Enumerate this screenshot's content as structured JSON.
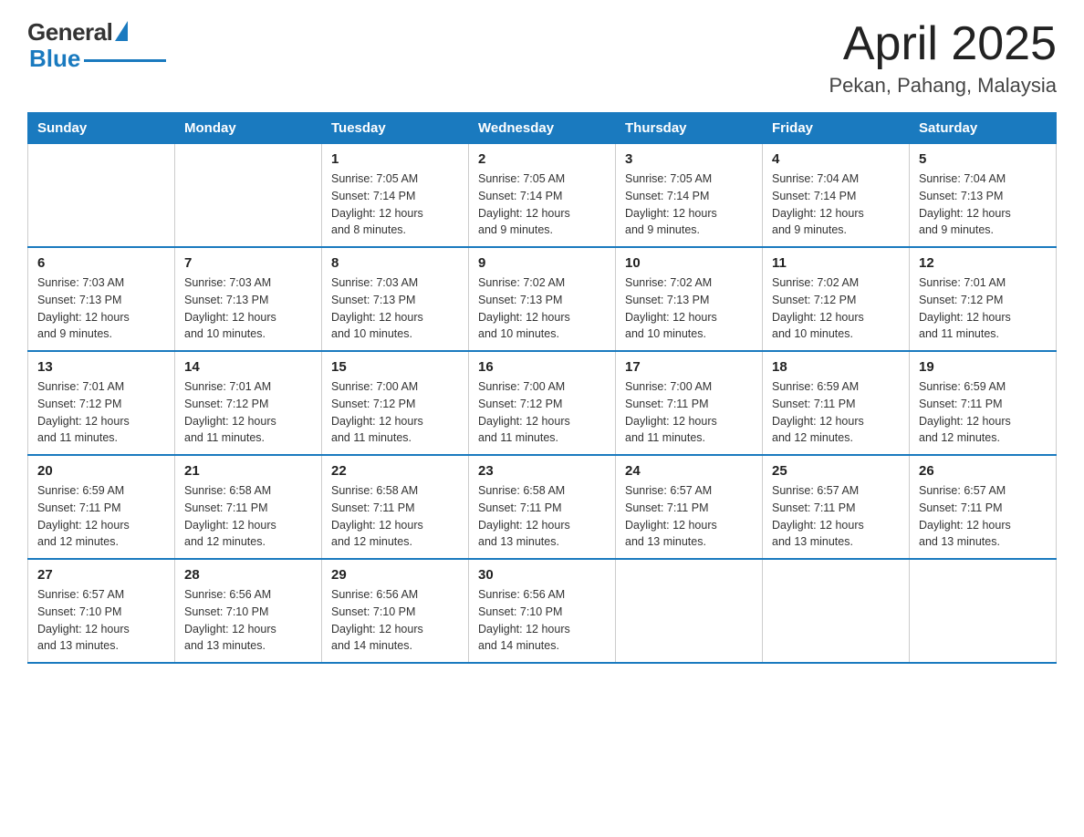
{
  "header": {
    "logo": {
      "general": "General",
      "blue": "Blue"
    },
    "title": "April 2025",
    "location": "Pekan, Pahang, Malaysia"
  },
  "days_of_week": [
    "Sunday",
    "Monday",
    "Tuesday",
    "Wednesday",
    "Thursday",
    "Friday",
    "Saturday"
  ],
  "weeks": [
    [
      {
        "day": "",
        "info": ""
      },
      {
        "day": "",
        "info": ""
      },
      {
        "day": "1",
        "info": "Sunrise: 7:05 AM\nSunset: 7:14 PM\nDaylight: 12 hours\nand 8 minutes."
      },
      {
        "day": "2",
        "info": "Sunrise: 7:05 AM\nSunset: 7:14 PM\nDaylight: 12 hours\nand 9 minutes."
      },
      {
        "day": "3",
        "info": "Sunrise: 7:05 AM\nSunset: 7:14 PM\nDaylight: 12 hours\nand 9 minutes."
      },
      {
        "day": "4",
        "info": "Sunrise: 7:04 AM\nSunset: 7:14 PM\nDaylight: 12 hours\nand 9 minutes."
      },
      {
        "day": "5",
        "info": "Sunrise: 7:04 AM\nSunset: 7:13 PM\nDaylight: 12 hours\nand 9 minutes."
      }
    ],
    [
      {
        "day": "6",
        "info": "Sunrise: 7:03 AM\nSunset: 7:13 PM\nDaylight: 12 hours\nand 9 minutes."
      },
      {
        "day": "7",
        "info": "Sunrise: 7:03 AM\nSunset: 7:13 PM\nDaylight: 12 hours\nand 10 minutes."
      },
      {
        "day": "8",
        "info": "Sunrise: 7:03 AM\nSunset: 7:13 PM\nDaylight: 12 hours\nand 10 minutes."
      },
      {
        "day": "9",
        "info": "Sunrise: 7:02 AM\nSunset: 7:13 PM\nDaylight: 12 hours\nand 10 minutes."
      },
      {
        "day": "10",
        "info": "Sunrise: 7:02 AM\nSunset: 7:13 PM\nDaylight: 12 hours\nand 10 minutes."
      },
      {
        "day": "11",
        "info": "Sunrise: 7:02 AM\nSunset: 7:12 PM\nDaylight: 12 hours\nand 10 minutes."
      },
      {
        "day": "12",
        "info": "Sunrise: 7:01 AM\nSunset: 7:12 PM\nDaylight: 12 hours\nand 11 minutes."
      }
    ],
    [
      {
        "day": "13",
        "info": "Sunrise: 7:01 AM\nSunset: 7:12 PM\nDaylight: 12 hours\nand 11 minutes."
      },
      {
        "day": "14",
        "info": "Sunrise: 7:01 AM\nSunset: 7:12 PM\nDaylight: 12 hours\nand 11 minutes."
      },
      {
        "day": "15",
        "info": "Sunrise: 7:00 AM\nSunset: 7:12 PM\nDaylight: 12 hours\nand 11 minutes."
      },
      {
        "day": "16",
        "info": "Sunrise: 7:00 AM\nSunset: 7:12 PM\nDaylight: 12 hours\nand 11 minutes."
      },
      {
        "day": "17",
        "info": "Sunrise: 7:00 AM\nSunset: 7:11 PM\nDaylight: 12 hours\nand 11 minutes."
      },
      {
        "day": "18",
        "info": "Sunrise: 6:59 AM\nSunset: 7:11 PM\nDaylight: 12 hours\nand 12 minutes."
      },
      {
        "day": "19",
        "info": "Sunrise: 6:59 AM\nSunset: 7:11 PM\nDaylight: 12 hours\nand 12 minutes."
      }
    ],
    [
      {
        "day": "20",
        "info": "Sunrise: 6:59 AM\nSunset: 7:11 PM\nDaylight: 12 hours\nand 12 minutes."
      },
      {
        "day": "21",
        "info": "Sunrise: 6:58 AM\nSunset: 7:11 PM\nDaylight: 12 hours\nand 12 minutes."
      },
      {
        "day": "22",
        "info": "Sunrise: 6:58 AM\nSunset: 7:11 PM\nDaylight: 12 hours\nand 12 minutes."
      },
      {
        "day": "23",
        "info": "Sunrise: 6:58 AM\nSunset: 7:11 PM\nDaylight: 12 hours\nand 13 minutes."
      },
      {
        "day": "24",
        "info": "Sunrise: 6:57 AM\nSunset: 7:11 PM\nDaylight: 12 hours\nand 13 minutes."
      },
      {
        "day": "25",
        "info": "Sunrise: 6:57 AM\nSunset: 7:11 PM\nDaylight: 12 hours\nand 13 minutes."
      },
      {
        "day": "26",
        "info": "Sunrise: 6:57 AM\nSunset: 7:11 PM\nDaylight: 12 hours\nand 13 minutes."
      }
    ],
    [
      {
        "day": "27",
        "info": "Sunrise: 6:57 AM\nSunset: 7:10 PM\nDaylight: 12 hours\nand 13 minutes."
      },
      {
        "day": "28",
        "info": "Sunrise: 6:56 AM\nSunset: 7:10 PM\nDaylight: 12 hours\nand 13 minutes."
      },
      {
        "day": "29",
        "info": "Sunrise: 6:56 AM\nSunset: 7:10 PM\nDaylight: 12 hours\nand 14 minutes."
      },
      {
        "day": "30",
        "info": "Sunrise: 6:56 AM\nSunset: 7:10 PM\nDaylight: 12 hours\nand 14 minutes."
      },
      {
        "day": "",
        "info": ""
      },
      {
        "day": "",
        "info": ""
      },
      {
        "day": "",
        "info": ""
      }
    ]
  ]
}
